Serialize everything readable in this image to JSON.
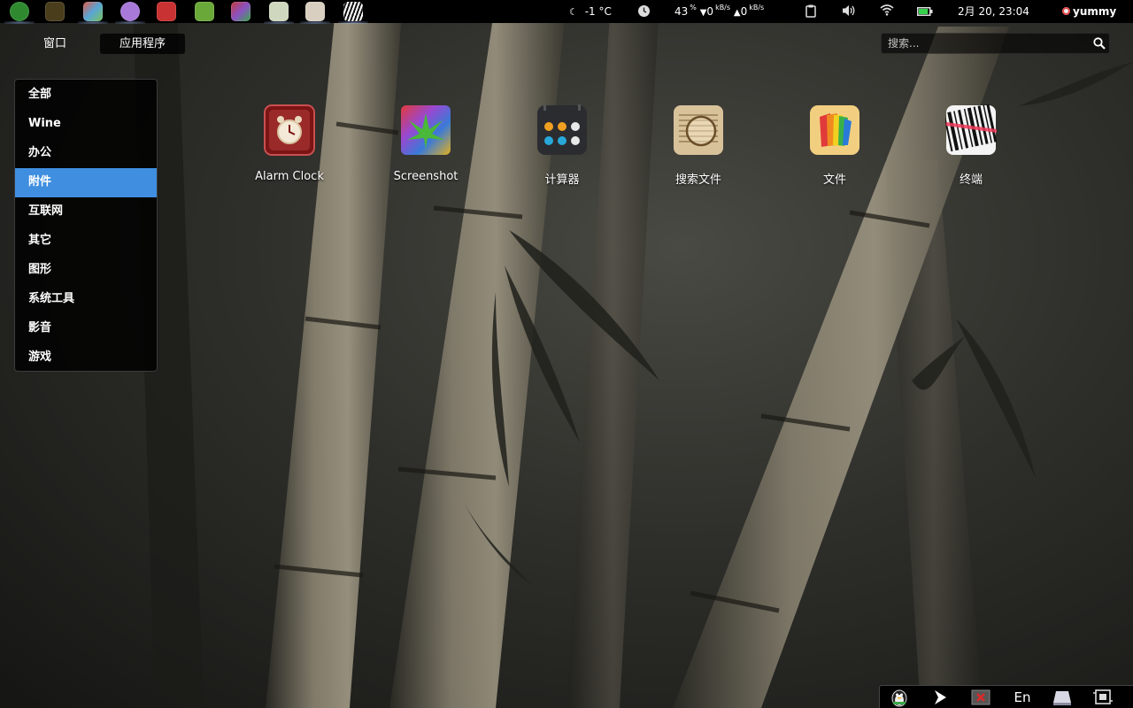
{
  "panel": {
    "launchers": [
      {
        "name": "deepin-logo-launcher",
        "color": "#3c9a3c"
      },
      {
        "name": "maps-launcher",
        "color": "#4a3d1c"
      },
      {
        "name": "color-picker-launcher",
        "color": "#58a6d6"
      },
      {
        "name": "chat-launcher",
        "color": "#a879d8"
      },
      {
        "name": "angry-birds-launcher",
        "color": "#c83232"
      },
      {
        "name": "android-launcher",
        "color": "#6aa83a"
      },
      {
        "name": "screenshot-launcher",
        "color": "#8a52c4"
      },
      {
        "name": "editor-launcher",
        "color": "#cfd8bf"
      },
      {
        "name": "player-launcher",
        "color": "#d8cfc0"
      },
      {
        "name": "terminal-launcher",
        "color": "#d82848"
      }
    ],
    "weather_temp": "-1 °C",
    "cpu_percent": "43",
    "cpu_unit": "%",
    "net_down_value": "0",
    "net_down_unit": "kB/s",
    "net_up_value": "0",
    "net_up_unit": "kB/s",
    "battery_level": 0.9,
    "datetime": "2月 20, 23:04",
    "username": "yummy"
  },
  "overview": {
    "tab_windows": "窗口",
    "tab_apps": "应用程序",
    "search_placeholder": "搜索..."
  },
  "categories": [
    "全部",
    "Wine",
    "办公",
    "附件",
    "互联网",
    "其它",
    "图形",
    "系统工具",
    "影音",
    "游戏"
  ],
  "selected_category": "附件",
  "apps": [
    {
      "label": "Alarm Clock",
      "icon": "alarm-clock-icon"
    },
    {
      "label": "Screenshot",
      "icon": "screenshot-icon"
    },
    {
      "label": "计算器",
      "icon": "calculator-icon"
    },
    {
      "label": "搜索文件",
      "icon": "search-files-icon"
    },
    {
      "label": "文件",
      "icon": "file-manager-icon"
    },
    {
      "label": "终端",
      "icon": "terminal-icon"
    }
  ],
  "tray": {
    "lang": "En"
  },
  "colors": {
    "selected": "#3f8ee0",
    "battery": "#35d04a"
  }
}
